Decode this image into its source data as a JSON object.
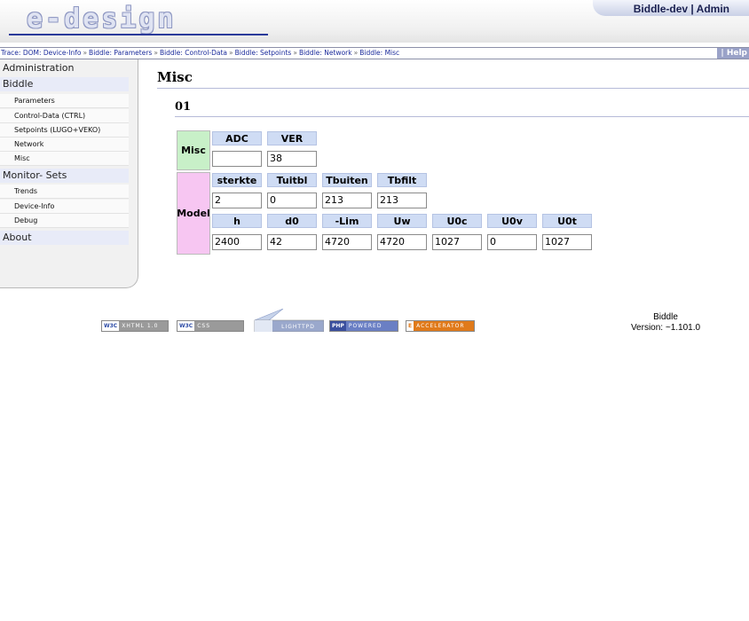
{
  "header": {
    "logo_text": "e-design",
    "user_label": "Biddle-dev | Admin"
  },
  "trace": {
    "prefix": "Trace:",
    "items": [
      "DOM: Device-Info",
      "Biddle: Parameters",
      "Biddle: Control-Data",
      "Biddle: Setpoints",
      "Biddle: Network",
      "Biddle: Misc"
    ],
    "help_label": "Help"
  },
  "sidebar": {
    "administration": "Administration",
    "biddle": "Biddle",
    "biddle_items": [
      "Parameters",
      "Control-Data (CTRL)",
      "Setpoints (LUGO+VEKO)",
      "Network",
      "Misc"
    ],
    "monitor_sets": "Monitor- Sets",
    "monitor_items": [
      "Trends",
      "Device-Info",
      "Debug"
    ],
    "about": "About"
  },
  "main": {
    "title": "Misc",
    "subtitle": "01",
    "misc_group": {
      "label": "Misc",
      "headers": [
        "ADC",
        "VER"
      ],
      "values": [
        "",
        "38"
      ]
    },
    "model_group": {
      "label": "Model",
      "headers1": [
        "sterkte",
        "Tuitbl",
        "Tbuiten",
        "Tbfilt"
      ],
      "values1": [
        "2",
        "0",
        "213",
        "213"
      ],
      "headers2": [
        "h",
        "d0",
        "-Lim",
        "Uw",
        "U0c",
        "U0v",
        "U0t"
      ],
      "values2": [
        "2400",
        "42",
        "4720",
        "4720",
        "1027",
        "0",
        "1027"
      ]
    }
  },
  "footer": {
    "badges": [
      {
        "left": "W3C",
        "right": "XHTML 1.0",
        "color": "#9a9a9a"
      },
      {
        "left": "W3C",
        "right": "CSS",
        "color": "#9a9a9a"
      },
      {
        "left": "PHP",
        "right": "POWERED",
        "color": "#6a7fc4"
      },
      {
        "left": "E",
        "right": "ACCELERATOR",
        "color": "#e07a1a"
      }
    ],
    "lighttpd_label": "LIGHTTPD",
    "app_name": "Biddle",
    "version": "Version: ~1.101.0"
  }
}
